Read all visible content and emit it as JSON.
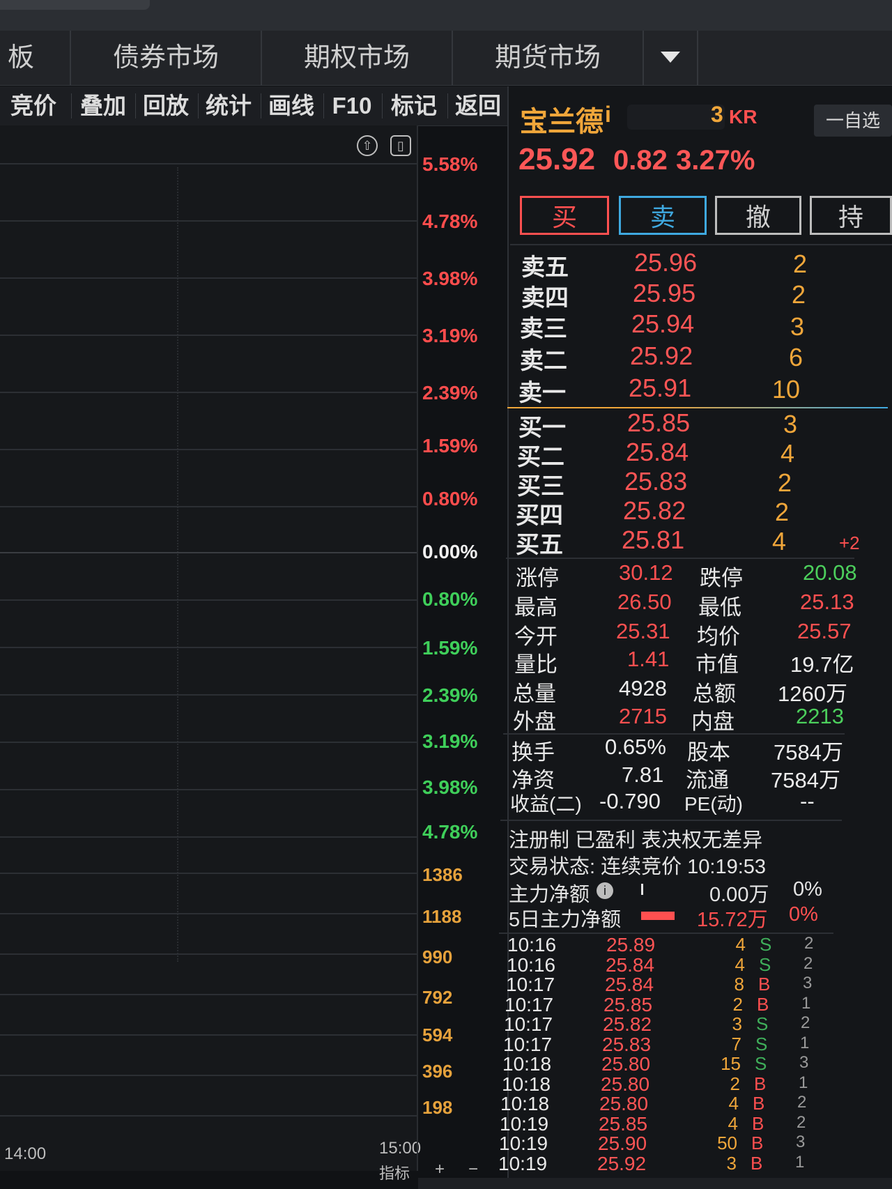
{
  "market_tabs": [
    "板",
    "债券市场",
    "期权市场",
    "期货市场"
  ],
  "toolbar": [
    "竞价",
    "叠加",
    "回放",
    "统计",
    "画线",
    "F10",
    "标记",
    "返回"
  ],
  "chart": {
    "pct_labels_up": [
      "5.58%",
      "4.78%",
      "3.98%",
      "3.19%",
      "2.39%",
      "1.59%",
      "0.80%"
    ],
    "pct_zero": "0.00%",
    "pct_labels_down": [
      "0.80%",
      "1.59%",
      "2.39%",
      "3.19%",
      "3.98%",
      "4.78%"
    ],
    "volume_labels": [
      "1386",
      "1188",
      "990",
      "792",
      "594",
      "396",
      "198"
    ],
    "time_start": "14:00",
    "time_end": "15:00",
    "indicator_label": "指标",
    "plus": "+",
    "minus": "−"
  },
  "stock": {
    "name": "宝兰德",
    "info_icon": "i",
    "code_suffix": "3",
    "market": "KR",
    "watch_button": "一自选",
    "price": "25.92",
    "change": "0.82",
    "change_pct": "3.27%"
  },
  "trade_buttons": {
    "buy": "买",
    "sell": "卖",
    "cancel": "撤",
    "hold": "持"
  },
  "order_book": {
    "asks": [
      {
        "label": "卖五",
        "price": "25.96",
        "qty": "2"
      },
      {
        "label": "卖四",
        "price": "25.95",
        "qty": "2"
      },
      {
        "label": "卖三",
        "price": "25.94",
        "qty": "3"
      },
      {
        "label": "卖二",
        "price": "25.92",
        "qty": "6"
      },
      {
        "label": "卖一",
        "price": "25.91",
        "qty": "10"
      }
    ],
    "bids": [
      {
        "label": "买一",
        "price": "25.85",
        "qty": "3",
        "extra": ""
      },
      {
        "label": "买二",
        "price": "25.84",
        "qty": "4",
        "extra": ""
      },
      {
        "label": "买三",
        "price": "25.83",
        "qty": "2",
        "extra": ""
      },
      {
        "label": "买四",
        "price": "25.82",
        "qty": "2",
        "extra": ""
      },
      {
        "label": "买五",
        "price": "25.81",
        "qty": "4",
        "extra": "+2"
      }
    ]
  },
  "stats": [
    {
      "l1": "涨停",
      "v1": "30.12",
      "l2": "跌停",
      "v2": "20.08"
    },
    {
      "l1": "最高",
      "v1": "26.50",
      "l2": "最低",
      "v2": "25.13"
    },
    {
      "l1": "今开",
      "v1": "25.31",
      "l2": "均价",
      "v2": "25.57"
    },
    {
      "l1": "量比",
      "v1": "1.41",
      "l2": "市值",
      "v2": "19.7亿"
    },
    {
      "l1": "总量",
      "v1": "4928",
      "l2": "总额",
      "v2": "1260万"
    },
    {
      "l1": "外盘",
      "v1": "2715",
      "l2": "内盘",
      "v2": "2213"
    }
  ],
  "stats2": [
    {
      "l1": "换手",
      "v1": "0.65%",
      "l2": "股本",
      "v2": "7584万"
    },
    {
      "l1": "净资",
      "v1": "7.81",
      "l2": "流通",
      "v2": "7584万"
    },
    {
      "l1": "收益(二)",
      "v1": "-0.790",
      "l2": "PE(动)",
      "v2": "--"
    }
  ],
  "info": {
    "tags": "注册制 已盈利 表决权无差异",
    "trade_status": "交易状态: 连续竞价 10:19:53",
    "main_net_label": "主力净额",
    "main_net_value": "0.00万",
    "main_net_pct": "0%",
    "main_net5_label": "5日主力净额",
    "main_net5_value": "15.72万",
    "main_net5_pct": "0%"
  },
  "ticks": [
    {
      "time": "10:16",
      "price": "25.89",
      "qty": "4",
      "side": "S",
      "n": "2"
    },
    {
      "time": "10:16",
      "price": "25.84",
      "qty": "4",
      "side": "S",
      "n": "2"
    },
    {
      "time": "10:17",
      "price": "25.84",
      "qty": "8",
      "side": "B",
      "n": "3"
    },
    {
      "time": "10:17",
      "price": "25.85",
      "qty": "2",
      "side": "B",
      "n": "1"
    },
    {
      "time": "10:17",
      "price": "25.82",
      "qty": "3",
      "side": "S",
      "n": "2"
    },
    {
      "time": "10:17",
      "price": "25.83",
      "qty": "7",
      "side": "S",
      "n": "1"
    },
    {
      "time": "10:18",
      "price": "25.80",
      "qty": "15",
      "side": "S",
      "n": "3"
    },
    {
      "time": "10:18",
      "price": "25.80",
      "qty": "2",
      "side": "B",
      "n": "1"
    },
    {
      "time": "10:18",
      "price": "25.80",
      "qty": "4",
      "side": "B",
      "n": "2"
    },
    {
      "time": "10:19",
      "price": "25.85",
      "qty": "4",
      "side": "B",
      "n": "2"
    },
    {
      "time": "10:19",
      "price": "25.90",
      "qty": "50",
      "side": "B",
      "n": "3"
    },
    {
      "time": "10:19",
      "price": "25.92",
      "qty": "3",
      "side": "B",
      "n": "1"
    }
  ],
  "colors": {
    "up": "#ff4d4d",
    "down": "#3fcf5a",
    "accent": "#f0a63a",
    "bg": "#101215"
  }
}
